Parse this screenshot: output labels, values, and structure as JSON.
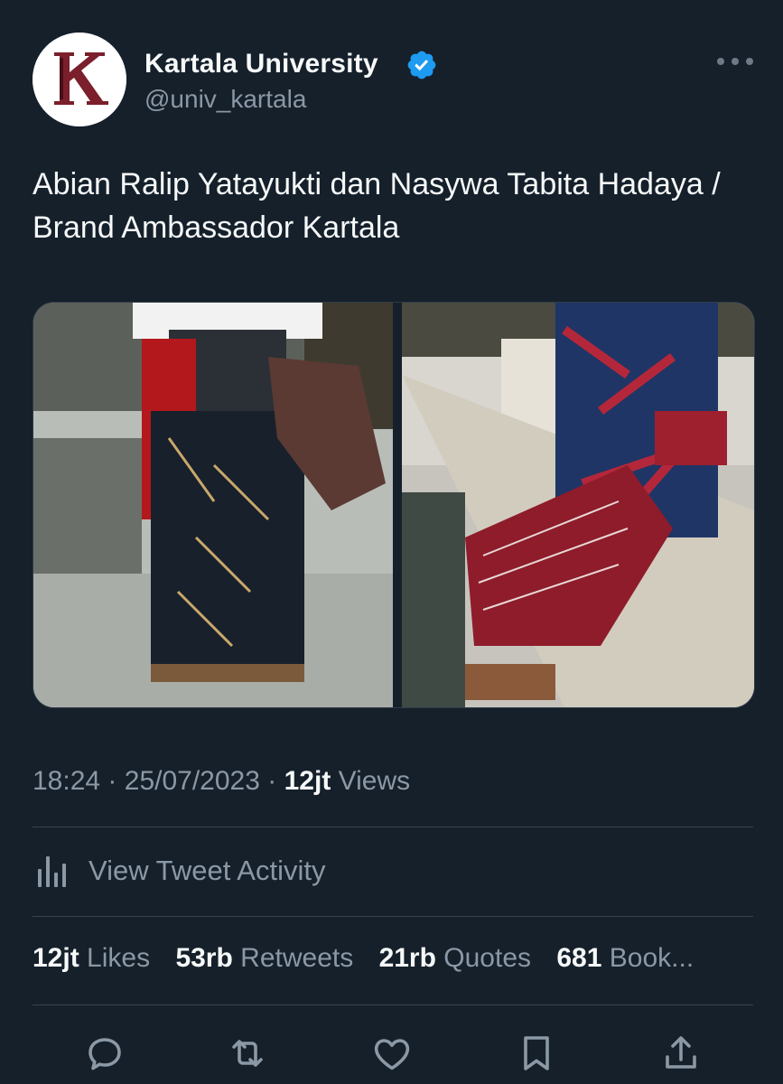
{
  "account": {
    "avatar_letter": "K",
    "display_name": "Kartala University",
    "handle": "@univ_kartala",
    "verified": true
  },
  "tweet": {
    "text": "Abian Ralip Yatayukti dan Nasywa Tabita Hadaya / Brand Ambassador Kartala"
  },
  "meta": {
    "time": "18:24",
    "date": "25/07/2023",
    "views_count": "12jt",
    "views_label": "Views",
    "separator": "·"
  },
  "activity": {
    "label": "View Tweet Activity"
  },
  "stats": [
    {
      "count": "12jt",
      "label": "Likes"
    },
    {
      "count": "53rb",
      "label": "Retweets"
    },
    {
      "count": "21rb",
      "label": "Quotes"
    },
    {
      "count": "681",
      "label": "Book..."
    }
  ],
  "actions": [
    "reply-icon",
    "retweet-icon",
    "like-icon",
    "bookmark-icon",
    "share-icon"
  ],
  "colors": {
    "background": "#15202b",
    "text_primary": "#f7f9f9",
    "text_secondary": "#8b98a5",
    "divider": "#38444d",
    "verified": "#1d9bf0",
    "avatar_mark": "#7a1f2b"
  }
}
